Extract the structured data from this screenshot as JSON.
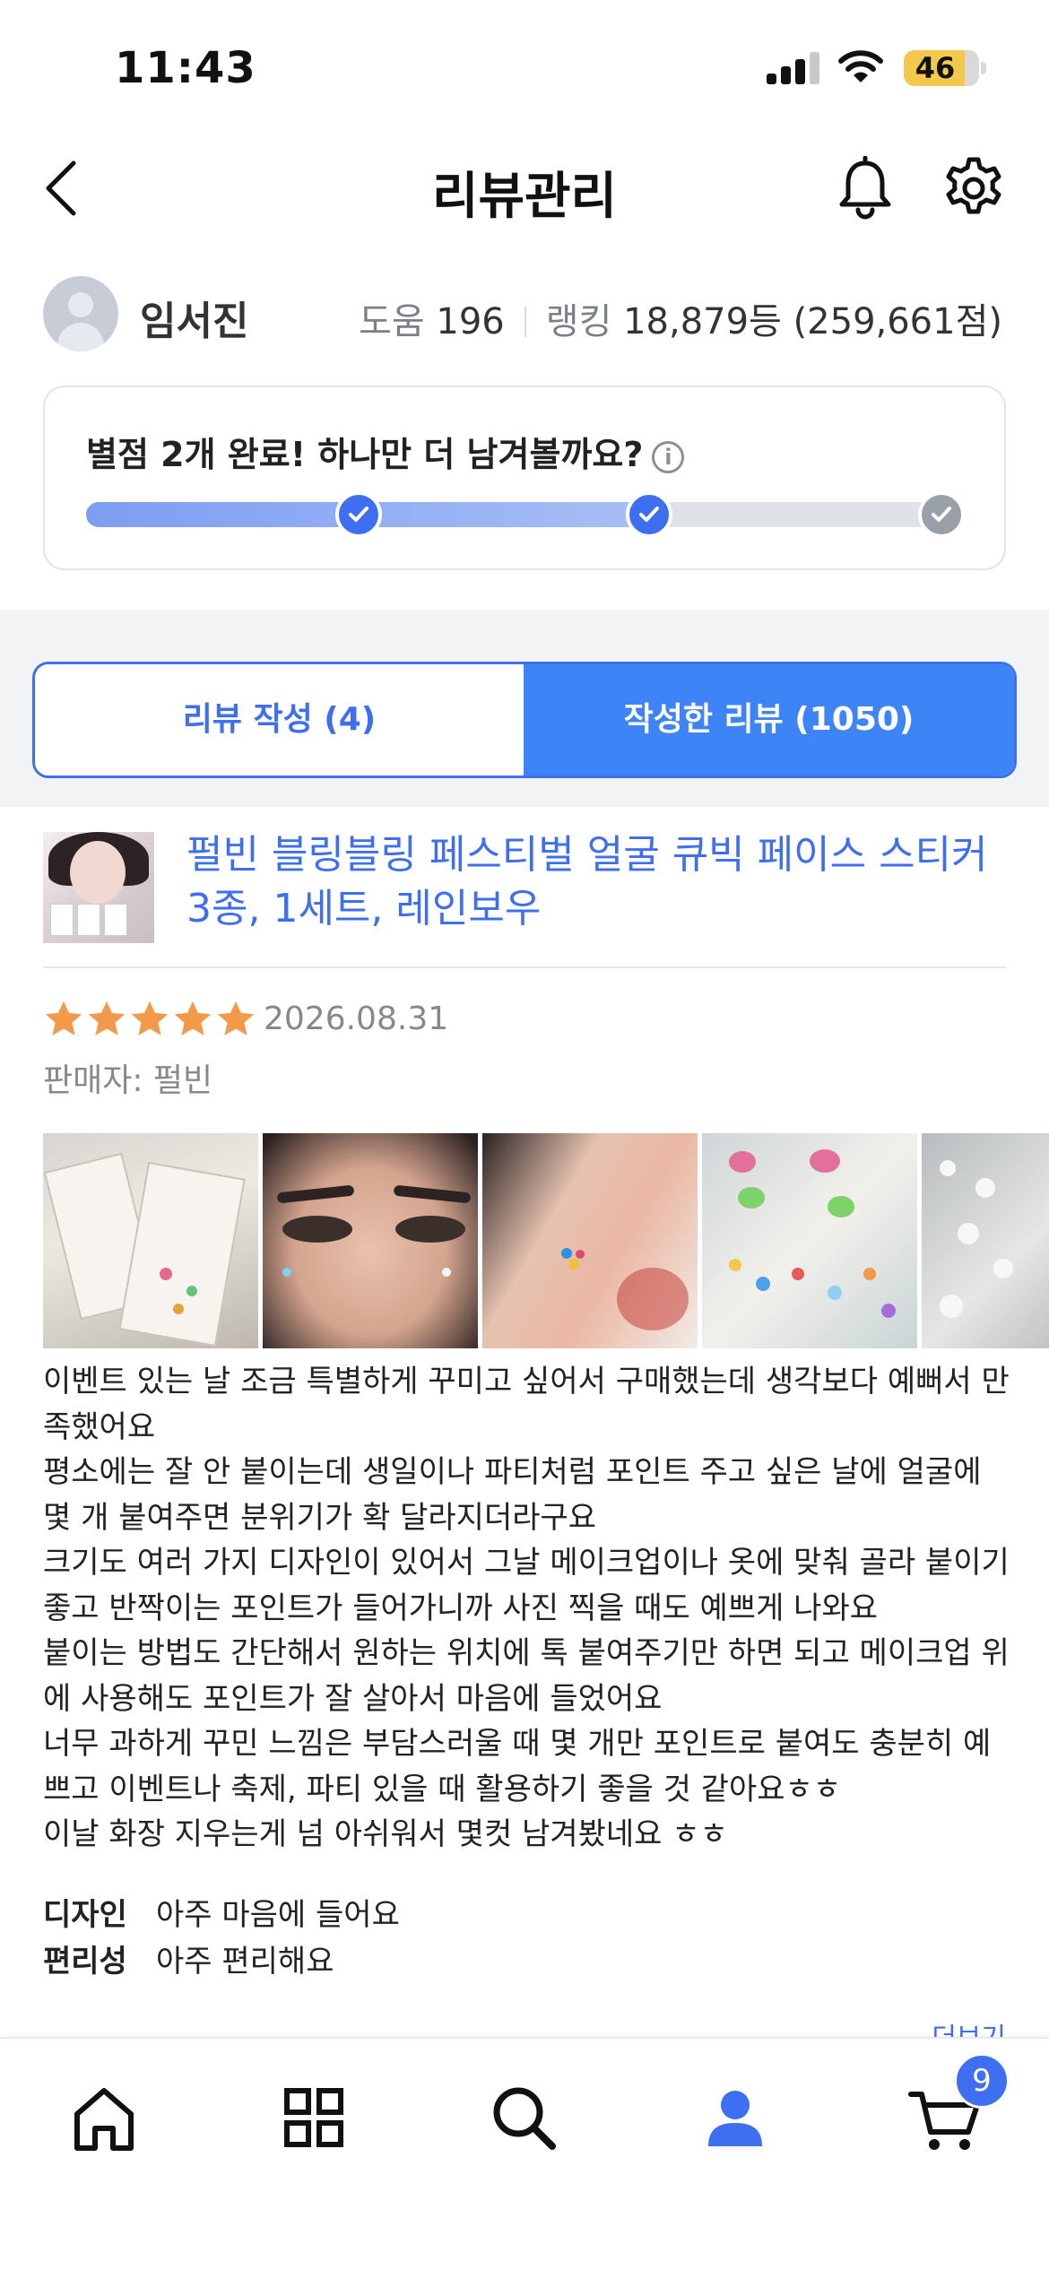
{
  "status_bar": {
    "time": "11:43",
    "battery": "46"
  },
  "nav": {
    "title": "리뷰관리"
  },
  "profile": {
    "name": "임서진",
    "help_label": "도움",
    "help_count": "196",
    "ranking_label": "랭킹",
    "ranking_value": "18,879등 (259,661점)"
  },
  "progress": {
    "message": "별점 2개 완료! 하나만 더 남겨볼까요?",
    "info_icon": "i",
    "completed_steps": 2,
    "total_steps": 3
  },
  "tabs": [
    {
      "label": "리뷰 작성 (4)",
      "active": false
    },
    {
      "label": "작성한 리뷰 (1050)",
      "active": true
    }
  ],
  "review": {
    "product_title": "펄빈 블링블링 페스티벌 얼굴 큐빅 페이스 스티커 3종, 1세트, 레인보우",
    "rating": 5,
    "date": "2026.08.31",
    "seller": "판매자: 펄빈",
    "body": [
      "이벤트 있는 날 조금 특별하게 꾸미고 싶어서 구매했는데 생각보다 예뻐서 만족했어요",
      "평소에는 잘 안 붙이는데 생일이나 파티처럼 포인트 주고 싶은 날에 얼굴에 몇 개 붙여주면 분위기가 확 달라지더라구요",
      "크기도 여러 가지 디자인이 있어서 그날 메이크업이나 옷에 맞춰 골라 붙이기 좋고 반짝이는 포인트가 들어가니까 사진 찍을 때도 예쁘게 나와요",
      "붙이는 방법도 간단해서 원하는 위치에 톡 붙여주기만 하면 되고 메이크업 위에 사용해도 포인트가 잘 살아서 마음에 들었어요",
      "너무 과하게 꾸민 느낌은 부담스러울 때 몇 개만 포인트로 붙여도 충분히 예쁘고 이벤트나 축제, 파티 있을 때 활용하기 좋을 것 같아요ㅎㅎ",
      "이날 화장 지우는게 넘 아쉬워서 몇컷 남겨봤네요 ㅎㅎ"
    ],
    "attributes": [
      {
        "key": "디자인",
        "value": "아주 마음에 들어요"
      },
      {
        "key": "편리성",
        "value": "아주 편리해요"
      }
    ],
    "more_link": "더보기"
  },
  "tabbar": {
    "items": [
      "home-icon",
      "category-icon",
      "search-icon",
      "my-page-icon",
      "cart-icon"
    ],
    "cart_count": "9"
  },
  "colors": {
    "accent": "#3d6ff0",
    "tab_active": "#3d84f7",
    "star": "#f2994a"
  }
}
